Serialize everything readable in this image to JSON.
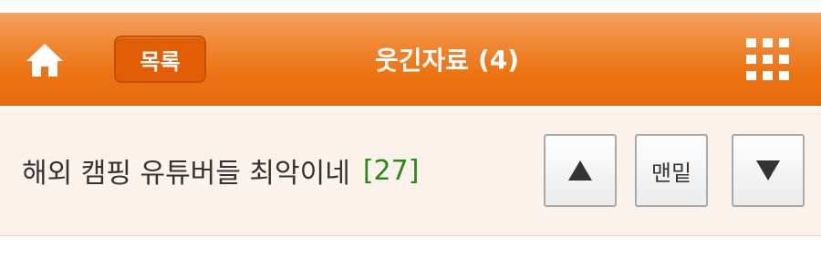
{
  "header": {
    "list_button_label": "목록",
    "title": "웃긴자료",
    "title_count": "(4)",
    "home_icon": "home-icon",
    "menu_icon": "grid-menu-icon",
    "colors": {
      "bar": "#ec7413",
      "list_button": "#e05c05"
    }
  },
  "post": {
    "title": "해외 캠핑 유튜버들 최악이네",
    "comment_count": "[27]",
    "colors": {
      "comment_count": "#2a8a12",
      "background": "#fbf2ec"
    }
  },
  "navigation": {
    "up_icon": "arrow-up-icon",
    "bottom_label": "맨밑",
    "down_icon": "arrow-down-icon"
  }
}
